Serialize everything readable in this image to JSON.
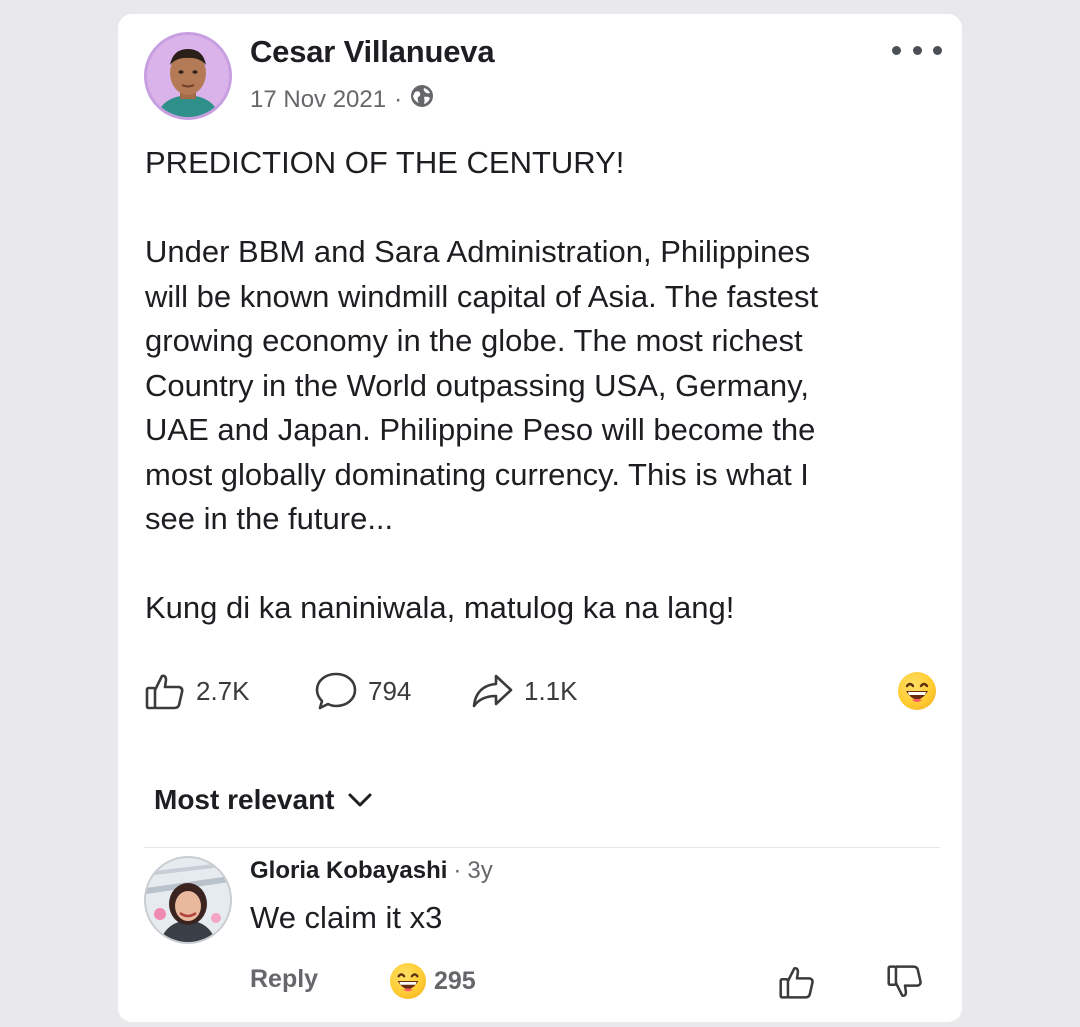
{
  "post": {
    "author": "Cesar Villanueva",
    "date": "17 Nov 2021",
    "separator": "·",
    "audience_icon": "globe-icon",
    "paragraphs": [
      [
        "PREDICTION OF THE CENTURY!"
      ],
      [
        "Under BBM and Sara Administration, Philippines",
        "will be known windmill capital of Asia. The fastest",
        "growing economy in the globe. The most richest",
        "Country in the World outpassing USA, Germany,",
        "UAE and Japan. Philippine Peso will become the",
        "most globally dominating currency. This is what I",
        "see in the future..."
      ],
      [
        "Kung di ka naniniwala, matulog ka na lang!"
      ]
    ],
    "likes": "2.7K",
    "comments": "794",
    "shares": "1.1K",
    "top_reaction_icon": "laughing-emoji-icon"
  },
  "comments_section": {
    "sort_label": "Most relevant",
    "comment": {
      "author": "Gloria Kobayashi",
      "separator": "·",
      "time": "3y",
      "text": "We claim it x3",
      "reply_label": "Reply",
      "reaction_count": "295",
      "reaction_icon": "laughing-emoji-icon"
    }
  },
  "colors": {
    "background": "#e9e9eb",
    "card": "#ffffff",
    "text": "#1c1e21",
    "secondary": "#65676b",
    "emoji": "#ffcc33"
  }
}
